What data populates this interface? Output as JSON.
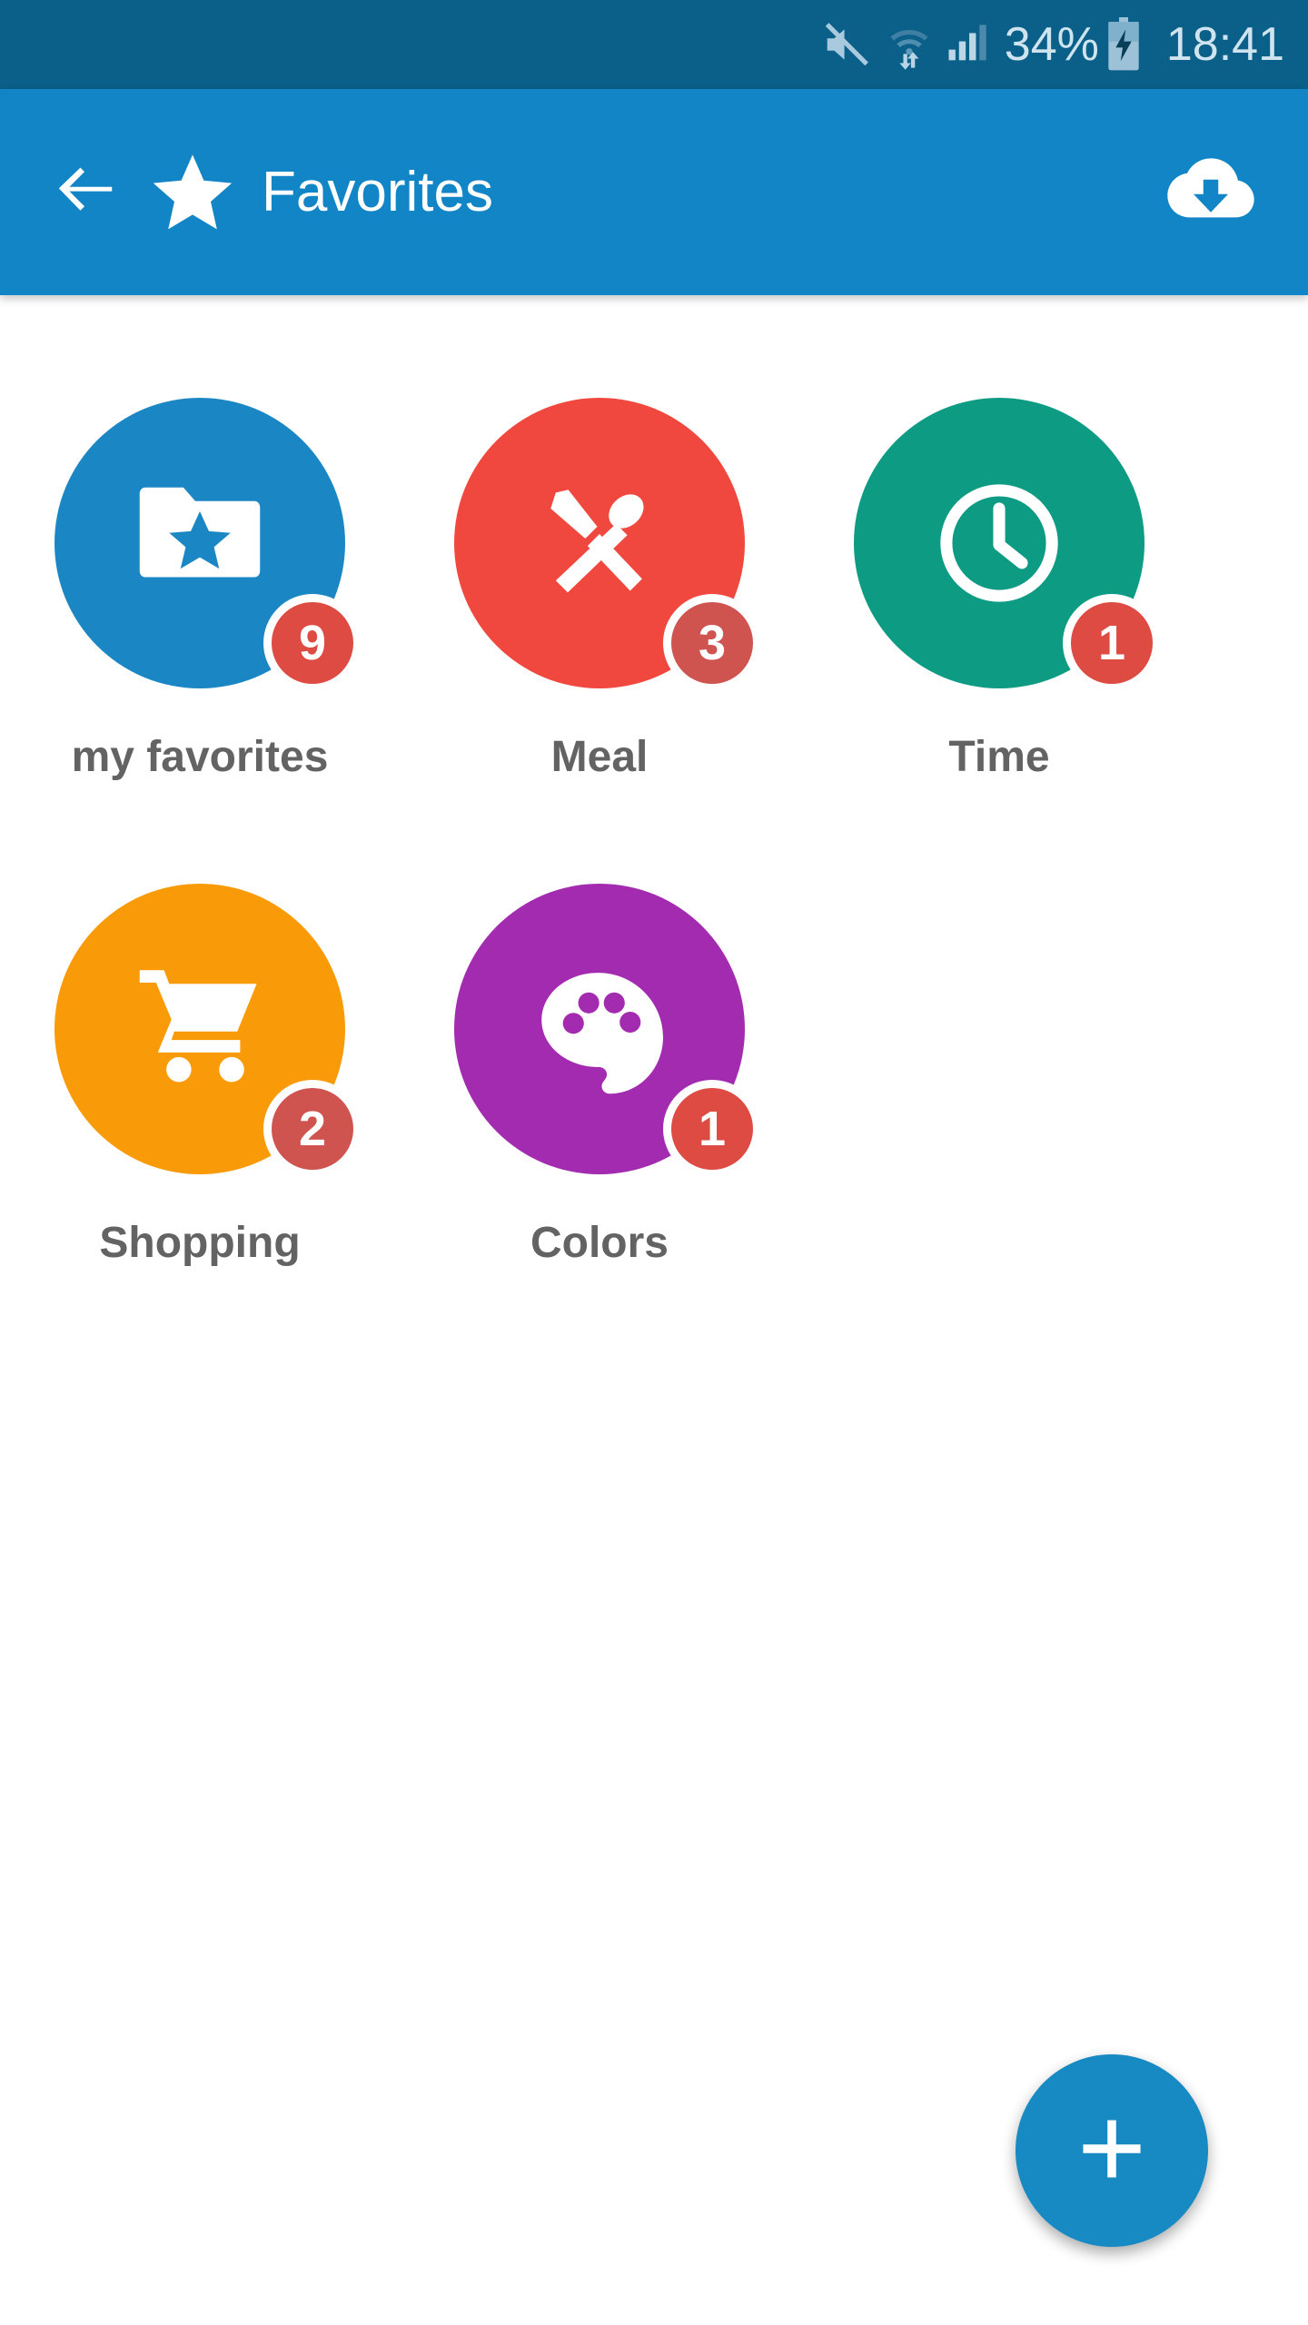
{
  "status_bar": {
    "mute_icon": "mute-icon",
    "wifi_icon": "wifi-icon",
    "signal_icon": "signal-icon",
    "battery_percent": "34%",
    "battery_icon": "battery-charging-icon",
    "time": "18:41",
    "background_color": "#0a6089",
    "text_color": "#cfe4ef"
  },
  "app_bar": {
    "back_icon": "back-arrow-icon",
    "logo_icon": "star-icon",
    "title": "Favorites",
    "download_icon": "cloud-download-icon",
    "background_color": "#1185c6"
  },
  "categories": [
    {
      "label": "my favorites",
      "badge": "9",
      "color": "#1a87c4",
      "icon": "folder-star-icon",
      "badge_color": "#dd4b43"
    },
    {
      "label": "Meal",
      "badge": "3",
      "color": "#f0483e",
      "icon": "cutlery-icon",
      "badge_color": "#cf544f"
    },
    {
      "label": "Time",
      "badge": "1",
      "color": "#0d9b83",
      "icon": "clock-icon",
      "badge_color": "#dd4b43"
    },
    {
      "label": "Shopping",
      "badge": "2",
      "color": "#f99b09",
      "icon": "shopping-cart-icon",
      "badge_color": "#cf544f"
    },
    {
      "label": "Colors",
      "badge": "1",
      "color": "#a32bb0",
      "icon": "palette-icon",
      "badge_color": "#dd4b43"
    }
  ],
  "fab": {
    "icon": "plus-icon",
    "label": "+",
    "color": "#1789c3"
  }
}
